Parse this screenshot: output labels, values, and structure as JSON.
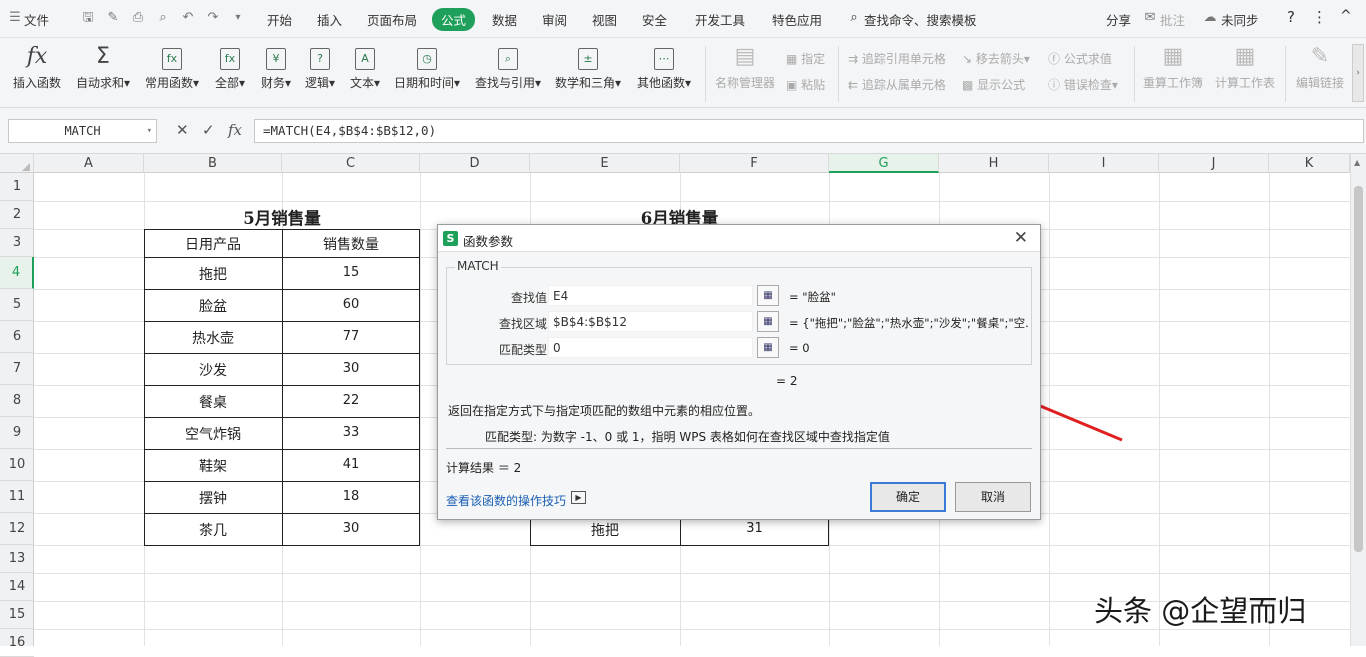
{
  "menu": {
    "file": "文件",
    "tabs": [
      "开始",
      "插入",
      "页面布局",
      "公式",
      "数据",
      "审阅",
      "视图",
      "安全",
      "开发工具",
      "特色应用"
    ],
    "active_tab": "公式",
    "search": "查找命令、搜索模板",
    "share": "分享",
    "annotate": "批注",
    "sync": "未同步",
    "help": "?",
    "more": "⋮"
  },
  "ribbon": {
    "insert_fn": "插入函数",
    "autosum": "自动求和",
    "common_fn": "常用函数",
    "all": "全部",
    "finance": "财务",
    "logic": "逻辑",
    "text": "文本",
    "datetime": "日期和时间",
    "lookup": "查找与引用",
    "math": "数学和三角",
    "other_fn": "其他函数",
    "name_mgr": "名称管理器",
    "define": "指定",
    "paste": "粘贴",
    "trace_prec": "追踪引用单元格",
    "trace_dep": "追踪从属单元格",
    "remove_arrows": "移去箭头",
    "show_formula": "显示公式",
    "eval_formula": "公式求值",
    "error_check": "错误检查",
    "recalc_wb": "重算工作簿",
    "calc_sheet": "计算工作表",
    "edit_links": "编辑链接"
  },
  "formula_bar": {
    "name_box": "MATCH",
    "formula": "=MATCH(E4,$B$4:$B$12,0)",
    "fx": "fx"
  },
  "columns": [
    "A",
    "B",
    "C",
    "D",
    "E",
    "F",
    "G",
    "H",
    "I",
    "J",
    "K"
  ],
  "rows": [
    "1",
    "2",
    "3",
    "4",
    "5",
    "6",
    "7",
    "8",
    "9",
    "10",
    "11",
    "12",
    "13",
    "14",
    "15",
    "16"
  ],
  "sheet": {
    "may_title": "5月销售量",
    "june_title": "6月销售量",
    "header_product": "日用产品",
    "header_qty": "销售数量",
    "may_products": [
      "拖把",
      "脸盆",
      "热水壶",
      "沙发",
      "餐桌",
      "空气炸锅",
      "鞋架",
      "摆钟",
      "茶几"
    ],
    "may_qty": [
      "15",
      "60",
      "77",
      "30",
      "22",
      "33",
      "41",
      "18",
      "30"
    ],
    "june_row12_product": "拖把",
    "june_row12_qty": "31"
  },
  "dialog": {
    "title": "函数参数",
    "fn_name": "MATCH",
    "params": [
      {
        "label": "查找值",
        "value": "E4",
        "result": "= \"脸盆\""
      },
      {
        "label": "查找区域",
        "value": "$B$4:$B$12",
        "result": "= {\"拖把\";\"脸盆\";\"热水壶\";\"沙发\";\"餐桌\";\"空..."
      },
      {
        "label": "匹配类型",
        "value": "0",
        "result": "= 0"
      }
    ],
    "fn_result": "= 2",
    "description": "返回在指定方式下与指定项匹配的数组中元素的相应位置。",
    "param_help": "匹配类型:  为数字 -1、0 或 1，指明 WPS 表格如何在查找区域中查找指定值",
    "calc_result": "计算结果 ＝ 2",
    "help_link": "查看该函数的操作技巧",
    "ok": "确定",
    "cancel": "取消"
  },
  "watermark": "头条 @企望而归",
  "colors": {
    "accent": "#1fa05a",
    "arrow": "#e02020",
    "link": "#1a5fb4"
  }
}
